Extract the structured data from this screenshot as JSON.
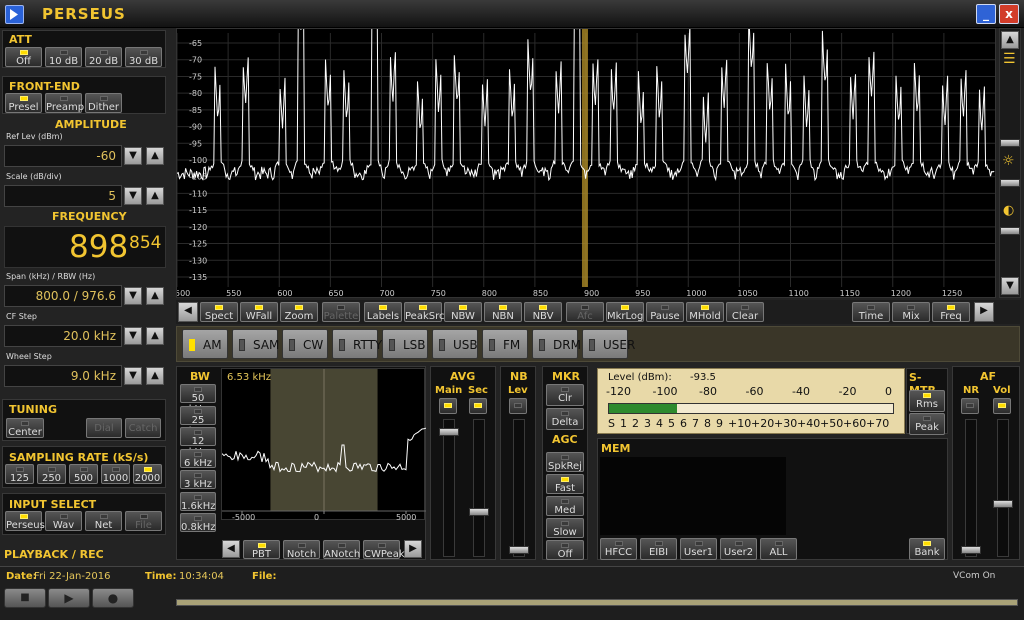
{
  "app": {
    "title": "PERSEUS"
  },
  "window": {
    "min_label": "_",
    "close_label": "x"
  },
  "att": {
    "title": "ATT",
    "buttons": [
      "Off",
      "10 dB",
      "20 dB",
      "30 dB"
    ],
    "active": "Off"
  },
  "frontend": {
    "title": "FRONT-END",
    "buttons": [
      "Presel",
      "Preamp",
      "Dither"
    ],
    "active": "Presel"
  },
  "amplitude": {
    "title": "AMPLITUDE",
    "ref_label": "Ref Lev (dBm)",
    "ref_value": "-60",
    "scale_label": "Scale (dB/div)",
    "scale_value": "5"
  },
  "frequency": {
    "title": "FREQUENCY",
    "main": "898",
    "sub": "854",
    "span_label": "Span (kHz) / RBW (Hz)",
    "span_value": "800.0 / 976.6",
    "cf_label": "CF Step",
    "cf_value": "20.0 kHz",
    "wheel_label": "Wheel Step",
    "wheel_value": "9.0 kHz"
  },
  "tuning": {
    "title": "TUNING",
    "center": "Center",
    "dial": "Dial",
    "catch": "Catch"
  },
  "sampling": {
    "title": "SAMPLING RATE (kS/s)",
    "buttons": [
      "125",
      "250",
      "500",
      "1000",
      "2000"
    ],
    "active": "2000"
  },
  "input": {
    "title": "INPUT SELECT",
    "buttons": [
      "Perseus",
      "Wav",
      "Net",
      "File"
    ],
    "active": "Perseus"
  },
  "playback": {
    "title": "PLAYBACK / REC"
  },
  "spectrum": {
    "y_ticks": [
      "-65",
      "-70",
      "-75",
      "-80",
      "-85",
      "-90",
      "-95",
      "-100",
      "-105",
      "-110",
      "-115",
      "-120",
      "-125",
      "-130",
      "-135"
    ],
    "x_ticks": [
      "500",
      "550",
      "600",
      "650",
      "700",
      "750",
      "800",
      "850",
      "900",
      "950",
      "1000",
      "1050",
      "1100",
      "1150",
      "1200",
      "1250"
    ],
    "x_range_khz": [
      500,
      1300
    ],
    "y_range_dbm": [
      -62,
      -138
    ],
    "marker_khz": 899,
    "peaks_khz": [
      540,
      567,
      603,
      621,
      648,
      666,
      693,
      711,
      738,
      756,
      774,
      801,
      828,
      846,
      873,
      891,
      909,
      927,
      954,
      972,
      999,
      1017,
      1035,
      1062,
      1080,
      1098,
      1116,
      1134,
      1161,
      1179,
      1206,
      1224,
      1251,
      1269,
      1287
    ],
    "peaks_dbm": [
      -90,
      -86,
      -92,
      -63,
      -88,
      -90,
      -62,
      -84,
      -94,
      -88,
      -86,
      -92,
      -90,
      -82,
      -88,
      -63,
      -86,
      -88,
      -92,
      -90,
      -76,
      -96,
      -86,
      -75,
      -88,
      -90,
      -93,
      -80,
      -90,
      -84,
      -92,
      -88,
      -92,
      -90,
      -94
    ],
    "noise_floor_dbm": -104
  },
  "spectrum_controls": {
    "left": [
      "Spect",
      "WFall",
      "Zoom",
      "Palette",
      "Labels",
      "PeakSrc",
      "NBW",
      "NBN",
      "NBV",
      "Afc",
      "MkrLog",
      "Pause",
      "MHold",
      "Clear"
    ],
    "right": [
      "Time",
      "Mix",
      "Freq"
    ]
  },
  "modes": {
    "items": [
      "AM",
      "SAM",
      "CW",
      "RTTY",
      "LSB",
      "USB",
      "FM",
      "DRM",
      "USER"
    ],
    "active": "AM"
  },
  "bw": {
    "title": "BW",
    "buttons": [
      "50 kHz",
      "25 kHz",
      "12 kHz",
      "6 kHz",
      "3 kHz",
      "1.6kHz",
      "0.8kHz"
    ],
    "value": "6.53 kHz",
    "ticks": [
      "-5000",
      "0",
      "5000"
    ],
    "controls": [
      "PBT",
      "Notch",
      "ANotch",
      "CWPeak"
    ]
  },
  "avg": {
    "title": "AVG",
    "main": "Main",
    "sec": "Sec"
  },
  "nb": {
    "title": "NB",
    "lev": "Lev"
  },
  "mkr": {
    "title": "MKR",
    "clr": "Clr",
    "delta": "Delta"
  },
  "agc": {
    "title": "AGC",
    "buttons": [
      "SpkRej",
      "Fast",
      "Med",
      "Slow",
      "Off"
    ]
  },
  "level": {
    "label": "Level (dBm):",
    "value": "-93.5",
    "top_ticks": [
      "-120",
      "-100",
      "-80",
      "-60",
      "-40",
      "-20",
      "0"
    ],
    "bottom_ticks": [
      "S",
      "1",
      "2",
      "3",
      "4",
      "5",
      "6",
      "7",
      "8",
      "9",
      "+10",
      "+20",
      "+30",
      "+40",
      "+50",
      "+60",
      "+70"
    ],
    "fill_fraction": 0.24
  },
  "smtr": {
    "title": "S-MTR",
    "rms": "Rms",
    "peak": "Peak"
  },
  "mem": {
    "title": "MEM",
    "buttons": [
      "HFCC",
      "EIBI",
      "User1",
      "User2",
      "ALL"
    ],
    "bank": "Bank"
  },
  "af": {
    "title": "AF",
    "nr": "NR",
    "vol": "Vol"
  },
  "status": {
    "date_label": "Date:",
    "date": "Fri 22-Jan-2016",
    "time_label": "Time:",
    "time": "10:34:04",
    "file_label": "File:",
    "vcom": "VCom On"
  },
  "colors": {
    "accent": "#f2c531",
    "trace": "#ffffff",
    "marker": "#b8942a",
    "led_on": "#ffdd00"
  }
}
